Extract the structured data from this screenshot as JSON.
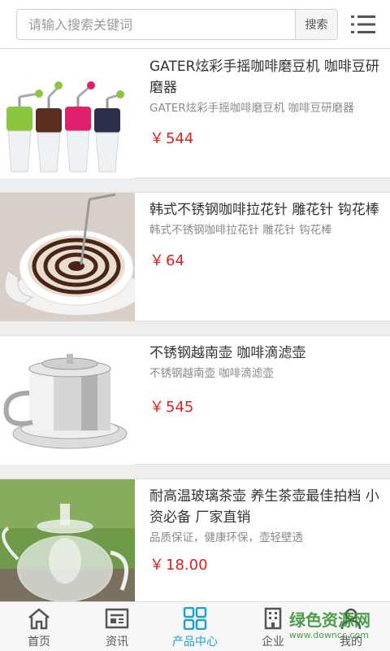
{
  "search": {
    "placeholder": "请输入搜索关键词",
    "button_label": "搜索"
  },
  "products": [
    {
      "title": "GATER炫彩手摇咖啡磨豆机 咖啡豆研磨器",
      "desc": "GATER炫彩手摇咖啡磨豆机 咖啡豆研磨器",
      "currency": "￥",
      "price": "544"
    },
    {
      "title": "韩式不锈钢咖啡拉花针 雕花针 钩花棒",
      "desc": "韩式不锈钢咖啡拉花针 雕花针 钩花棒",
      "currency": "￥",
      "price": "64"
    },
    {
      "title": "不锈钢越南壶 咖啡滴滤壶",
      "desc": "不锈钢越南壶 咖啡滴滤壶",
      "currency": "￥",
      "price": "545"
    },
    {
      "title": "耐高温玻璃茶壶 养生茶壶最佳拍档 小资必备 厂家直销",
      "desc": "品质保证，健康环保，壶轻壁透",
      "currency": "￥",
      "price": "18.00"
    }
  ],
  "nav": {
    "home": "首页",
    "news": "资讯",
    "products": "产品中心",
    "company": "企业",
    "mine": "我的"
  },
  "watermark": {
    "text": "绿色资源网",
    "url": "www.downcc.com"
  },
  "colors": {
    "price": "#e02020",
    "active_nav": "#1aa0d8",
    "separator": "#eeeeee"
  }
}
